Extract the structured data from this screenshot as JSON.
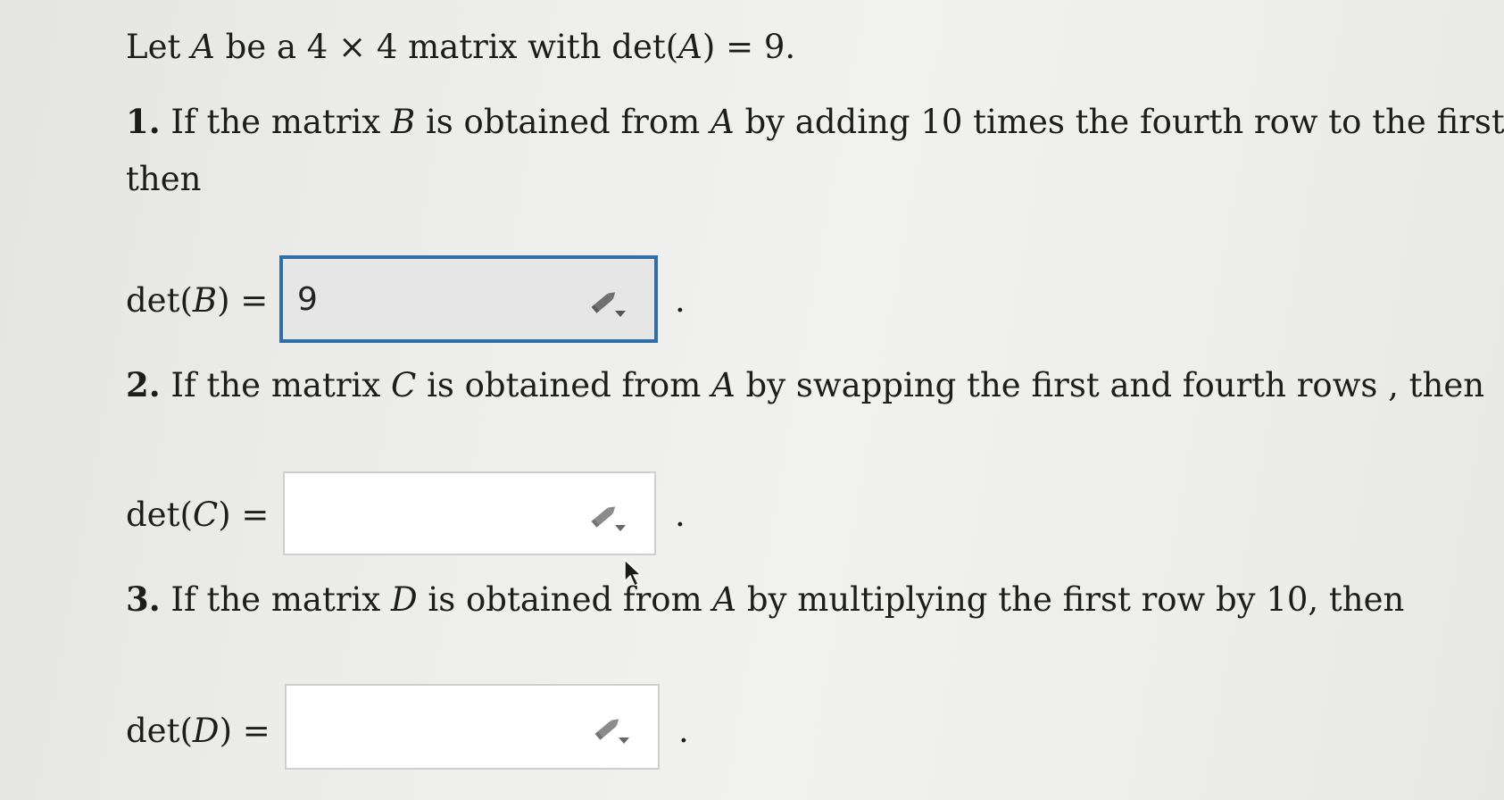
{
  "intro": {
    "text_a": "Let ",
    "var_a": "A",
    "text_b": " be a 4 × 4 matrix with det(",
    "var_a2": "A",
    "text_c": ") = 9."
  },
  "questions": [
    {
      "number": "1.",
      "line1_a": " If the matrix ",
      "line1_var": "B",
      "line1_b": " is obtained from ",
      "line1_var2": "A",
      "line1_c": " by adding 10 times the fourth row to the first,",
      "line2": "then",
      "det_prefix": "det(",
      "det_var": "B",
      "det_suffix": ") =",
      "answer": "9",
      "period": "."
    },
    {
      "number": "2.",
      "line1_a": " If the matrix ",
      "line1_var": "C",
      "line1_b": " is obtained from ",
      "line1_var2": "A",
      "line1_c": " by swapping the first and fourth rows , then",
      "det_prefix": "det(",
      "det_var": "C",
      "det_suffix": ") =",
      "answer": "",
      "period": "."
    },
    {
      "number": "3.",
      "line1_a": " If the matrix ",
      "line1_var": "D",
      "line1_b": " is obtained from ",
      "line1_var2": "A",
      "line1_c": " by multiplying the first row by 10, then",
      "det_prefix": "det(",
      "det_var": "D",
      "det_suffix": ") =",
      "answer": "",
      "period": "."
    }
  ],
  "icons": {
    "answer_tool": "pencil-dropdown-icon",
    "pointer": "mouse-cursor-icon"
  },
  "colors": {
    "active_border": "#2f6fa8",
    "active_fill": "#e6e6e6"
  }
}
